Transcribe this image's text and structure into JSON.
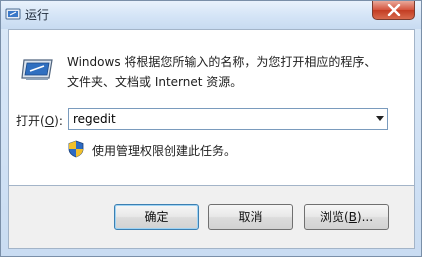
{
  "window": {
    "title": "运行"
  },
  "description": {
    "line1": "Windows 将根据您所输入的名称，为您打开相应的程序、",
    "line2": "文件夹、文档或 Internet 资源。"
  },
  "open_field": {
    "label_prefix": "打开(",
    "label_accel": "O",
    "label_suffix": "):",
    "value": "regedit"
  },
  "admin_note": "使用管理权限创建此任务。",
  "buttons": {
    "ok": "确定",
    "cancel": "取消",
    "browse_prefix": "浏览(",
    "browse_accel": "B",
    "browse_suffix": ")..."
  },
  "icons": {
    "title": "run-icon",
    "close": "close-icon",
    "run": "run-dialog-icon",
    "shield": "uac-shield-icon",
    "dropdown": "chevron-down-icon"
  },
  "colors": {
    "close_red": "#c33c22",
    "accent_blue": "#3c7fb1"
  }
}
